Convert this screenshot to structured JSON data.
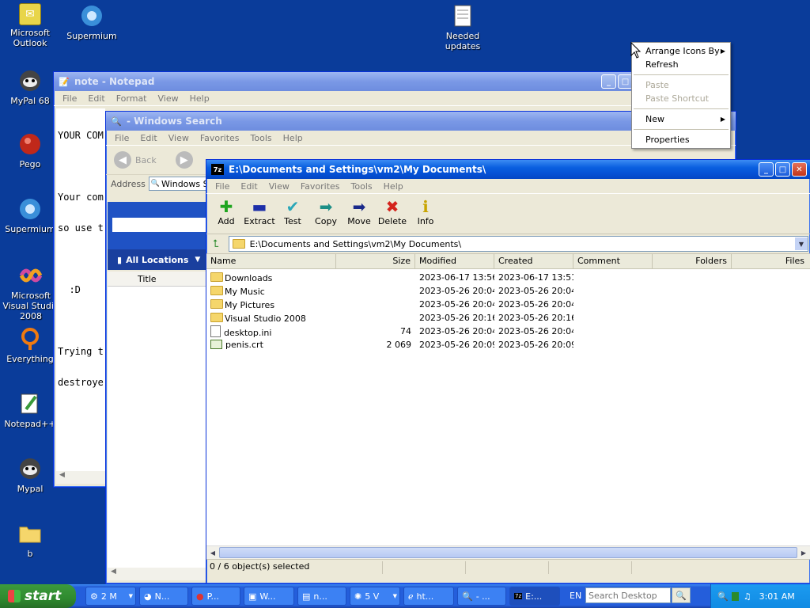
{
  "desktop_icons": [
    {
      "label": "Microsoft Outlook",
      "icon": "outlook-icon"
    },
    {
      "label": "Supermium",
      "icon": "supermium-icon"
    },
    {
      "label": "Needed updates",
      "icon": "text-file-icon"
    },
    {
      "label": "MyPal 68",
      "icon": "mypal-icon"
    },
    {
      "label": "Pego",
      "icon": "pego-icon"
    },
    {
      "label": "Supermium",
      "icon": "supermium-icon"
    },
    {
      "label": "Microsoft Visual Studio 2008",
      "icon": "visual-studio-icon"
    },
    {
      "label": "Everything",
      "icon": "everything-icon"
    },
    {
      "label": "Notepad++",
      "icon": "notepadpp-icon"
    },
    {
      "label": "Mypal",
      "icon": "mypal-icon"
    },
    {
      "label": "b",
      "icon": "folder-icon"
    }
  ],
  "notepad": {
    "title": "note - Notepad",
    "menu": [
      "File",
      "Edit",
      "Format",
      "View",
      "Help"
    ],
    "lines": [
      "YOUR COM",
      "",
      "Your com",
      "so use t",
      "",
      "  :D",
      "",
      "Trying t",
      "destroye"
    ]
  },
  "search": {
    "title": "- Windows Search",
    "menu": [
      "File",
      "Edit",
      "View",
      "Favorites",
      "Tools",
      "Help"
    ],
    "back": "Back",
    "address_label": "Address",
    "address_value": "Windows S",
    "all_locations": "All Locations",
    "title_col": "Title"
  },
  "sevenzip": {
    "title": "E:\\Documents and Settings\\vm2\\My Documents\\",
    "menu": [
      "File",
      "Edit",
      "View",
      "Favorites",
      "Tools",
      "Help"
    ],
    "toolbar": [
      {
        "label": "Add",
        "icon": "add-icon",
        "color": "#1fa51f",
        "glyph": "✚"
      },
      {
        "label": "Extract",
        "icon": "extract-icon",
        "color": "#1d2fa8",
        "glyph": "▬"
      },
      {
        "label": "Test",
        "icon": "test-icon",
        "color": "#2aa7b8",
        "glyph": "✔"
      },
      {
        "label": "Copy",
        "icon": "copy-icon",
        "color": "#1c8f86",
        "glyph": "➡"
      },
      {
        "label": "Move",
        "icon": "move-icon",
        "color": "#1a2a8a",
        "glyph": "➡"
      },
      {
        "label": "Delete",
        "icon": "delete-icon",
        "color": "#d4231c",
        "glyph": "✖"
      },
      {
        "label": "Info",
        "icon": "info-icon",
        "color": "#c8a400",
        "glyph": "ℹ"
      }
    ],
    "path": "E:\\Documents and Settings\\vm2\\My Documents\\",
    "columns": [
      "Name",
      "Size",
      "Modified",
      "Created",
      "Comment",
      "Folders",
      "Files"
    ],
    "rows": [
      {
        "name": "Downloads",
        "type": "folder",
        "size": "",
        "modified": "2023-06-17 13:56",
        "created": "2023-06-17 13:51"
      },
      {
        "name": "My Music",
        "type": "folder",
        "size": "",
        "modified": "2023-05-26 20:04",
        "created": "2023-05-26 20:04"
      },
      {
        "name": "My Pictures",
        "type": "folder",
        "size": "",
        "modified": "2023-05-26 20:04",
        "created": "2023-05-26 20:04"
      },
      {
        "name": "Visual Studio 2008",
        "type": "folder",
        "size": "",
        "modified": "2023-05-26 20:16",
        "created": "2023-05-26 20:16"
      },
      {
        "name": "desktop.ini",
        "type": "file",
        "size": "74",
        "modified": "2023-05-26 20:04",
        "created": "2023-05-26 20:04"
      },
      {
        "name": "penis.crt",
        "type": "cert",
        "size": "2 069",
        "modified": "2023-05-26 20:09",
        "created": "2023-05-26 20:09"
      }
    ],
    "status": "0 / 6 object(s) selected"
  },
  "context_menu": [
    {
      "label": "Arrange Icons By",
      "enabled": true,
      "submenu": true
    },
    {
      "label": "Refresh",
      "enabled": true,
      "submenu": false
    },
    {
      "sep": true
    },
    {
      "label": "Paste",
      "enabled": false,
      "submenu": false
    },
    {
      "label": "Paste Shortcut",
      "enabled": false,
      "submenu": false
    },
    {
      "sep": true
    },
    {
      "label": "New",
      "enabled": true,
      "submenu": true
    },
    {
      "sep": true
    },
    {
      "label": "Properties",
      "enabled": true,
      "submenu": false
    }
  ],
  "taskbar": {
    "start": "start",
    "tasks": [
      "2 M",
      "N...",
      "P...",
      "W...",
      "n...",
      "5 V",
      "ht...",
      "- ...",
      "E:..."
    ],
    "lang": "EN",
    "search_placeholder": "Search Desktop",
    "clock": "3:01 AM"
  }
}
